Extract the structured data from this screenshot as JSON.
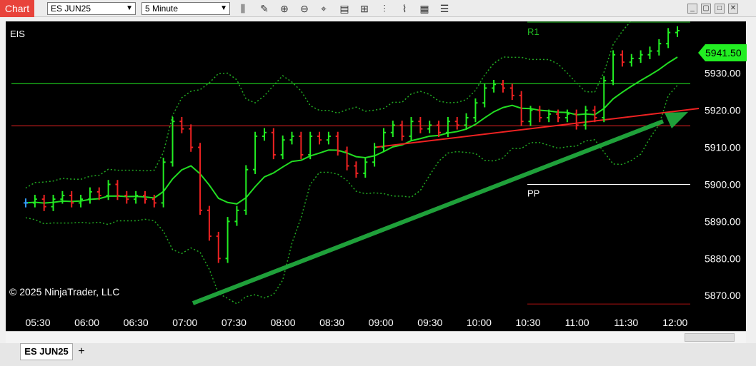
{
  "window": {
    "title": "Chart",
    "instrument_select": "ES JUN25",
    "interval_select": "5 Minute"
  },
  "toolbar_icons": [
    "bar-type-icon",
    "draw-tool-icon",
    "zoom-in-icon",
    "zoom-out-icon",
    "crosshair-icon",
    "data-box-icon",
    "indicators-icon",
    "strategies-icon",
    "chart-style-icon",
    "templates-icon",
    "properties-icon"
  ],
  "chart": {
    "instrument_label": "EIS",
    "copyright": "© 2025 NinjaTrader, LLC",
    "current_price": "5941.50",
    "level_labels": {
      "r1": "R1",
      "pp": "PP"
    }
  },
  "chart_data": {
    "type": "bar",
    "x_ticks": [
      "05:30",
      "06:00",
      "06:30",
      "07:00",
      "07:30",
      "08:00",
      "08:30",
      "09:00",
      "09:30",
      "10:00",
      "10:30",
      "11:00",
      "11:30",
      "12:00"
    ],
    "y_ticks": [
      "5930.00",
      "5920.00",
      "5910.00",
      "5900.00",
      "5890.00",
      "5880.00",
      "5870.00"
    ],
    "ylim": [
      5866,
      5944
    ],
    "close_series": [
      5895,
      5896,
      5894,
      5896,
      5897,
      5895,
      5896,
      5898,
      5897,
      5900,
      5897,
      5896,
      5897,
      5896,
      5895,
      5906,
      5917,
      5915,
      5910,
      5893,
      5886,
      5880,
      5890,
      5893,
      5904,
      5913,
      5914,
      5908,
      5912,
      5913,
      5908,
      5913,
      5912,
      5913,
      5909,
      5905,
      5903,
      5906,
      5910,
      5914,
      5916,
      5913,
      5917,
      5915,
      5916,
      5914,
      5917,
      5916,
      5918,
      5922,
      5926,
      5927,
      5926,
      5924,
      5917,
      5920,
      5918,
      5919,
      5918,
      5919,
      5916,
      5920,
      5918,
      5928,
      5935,
      5933,
      5934,
      5935,
      5936,
      5938,
      5941,
      5941.5
    ],
    "series": [
      {
        "name": "EMA",
        "color": "#22dd22"
      },
      {
        "name": "Bollinger",
        "color": "#22aa22"
      },
      {
        "name": "Trendline",
        "color": "#ee2222"
      }
    ],
    "levels": [
      {
        "label": "R1",
        "value": 5943.8,
        "color": "#22bb22"
      },
      {
        "label": "PP",
        "value": 5900.0,
        "color": "#ffffff"
      },
      {
        "label": "",
        "value": 5927.2,
        "color": "#22ee22"
      },
      {
        "label": "",
        "value": 5915.8,
        "color": "#ee2222"
      },
      {
        "label": "",
        "value": 5867.7,
        "color": "#aa1111"
      }
    ],
    "annotation": "arrow"
  },
  "tabs": {
    "active": "ES JUN25",
    "add": "+"
  },
  "colors": {
    "up": "#22ee22",
    "down": "#ee2222",
    "neutral": "#3399ff",
    "background": "#000000"
  }
}
